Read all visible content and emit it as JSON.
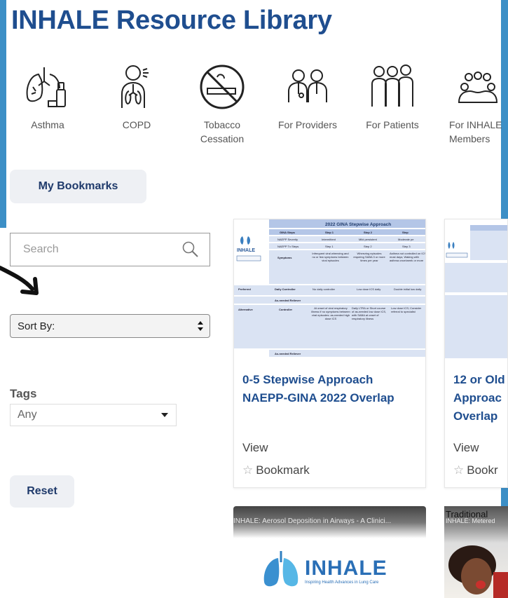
{
  "page": {
    "title": "INHALE Resource Library"
  },
  "categories": [
    {
      "label": "Asthma",
      "icon": "lungs-inhaler-icon"
    },
    {
      "label": "COPD",
      "icon": "person-lungs-icon"
    },
    {
      "label": "Tobacco\nCessation",
      "icon": "no-smoking-icon"
    },
    {
      "label": "For Providers",
      "icon": "doctors-icon"
    },
    {
      "label": "For Patients",
      "icon": "patients-group-icon"
    },
    {
      "label": "For INHALE\nMembers",
      "icon": "members-group-icon"
    }
  ],
  "bookmarks_button": "My Bookmarks",
  "search": {
    "placeholder": "Search"
  },
  "sort": {
    "label": "Sort By:"
  },
  "tags": {
    "label": "Tags",
    "value": "Any"
  },
  "reset_button": "Reset",
  "cards": [
    {
      "title_line1": "0-5 Stepwise Approach",
      "title_line2": "NAEPP-GINA 2022 Overlap",
      "view": "View",
      "bookmark": "Bookmark",
      "thumbnail": {
        "heading": "2022 GINA Stepwise Approach",
        "logo": "INHALE",
        "row_labels": [
          "Preferred",
          "Alternative"
        ],
        "sub_labels": [
          "Daily Controller",
          "As-needed Reliever",
          "Controller",
          "As-needed Reliever"
        ],
        "col_heads": [
          "GINA Steps",
          "Step 1",
          "Step 2",
          "Step"
        ],
        "severity_row": [
          "NAEPP Severity",
          "Intermittent",
          "Mild persistent",
          "Moderate pe"
        ],
        "naepp_row": [
          "NAEPP Tx Steps",
          "Step 1",
          "Step 2",
          "Step 3"
        ],
        "symptoms_label": "Symptoms",
        "step1_symptoms": "Infrequent viral wheezing and no or few symptoms between viral episodes",
        "step2_symptoms": "Wheezing episodes requiring SABA 3 or more times per year",
        "step3_symptoms": "Asthma not controlled on ICS most days; Waking with asthma once/week or more",
        "preferred_1": "No daily controller",
        "preferred_2": "Low dose ICS daily",
        "preferred_3": "Double initial low daily",
        "alt_1": "At onset of viral respiratory illness if no symptoms between viral episodes: as-needed high dose ICS",
        "alt_2": "Daily LTRA or Short course of as-needed low dose ICS, with SABA at onset of respiratory illness",
        "alt_3": "Low dose ICS; Consider referral to specialist"
      }
    },
    {
      "title_line1": "12 or Old",
      "title_line2": "Approac",
      "title_line3": "Overlap",
      "view": "View",
      "bookmark": "Bookr"
    }
  ],
  "videos": [
    {
      "title": "INHALE: Aerosol Deposition in Airways - A Clinici...",
      "logo_text": "INHALE",
      "logo_sub": "Inspiring Health Advances in Lung Care"
    },
    {
      "title_overlay": "Traditional",
      "title": "INHALE: Metered"
    }
  ],
  "colors": {
    "brand_blue": "#1f4e8f",
    "frame_blue": "#3c8fc6",
    "button_bg": "#eef0f4"
  }
}
